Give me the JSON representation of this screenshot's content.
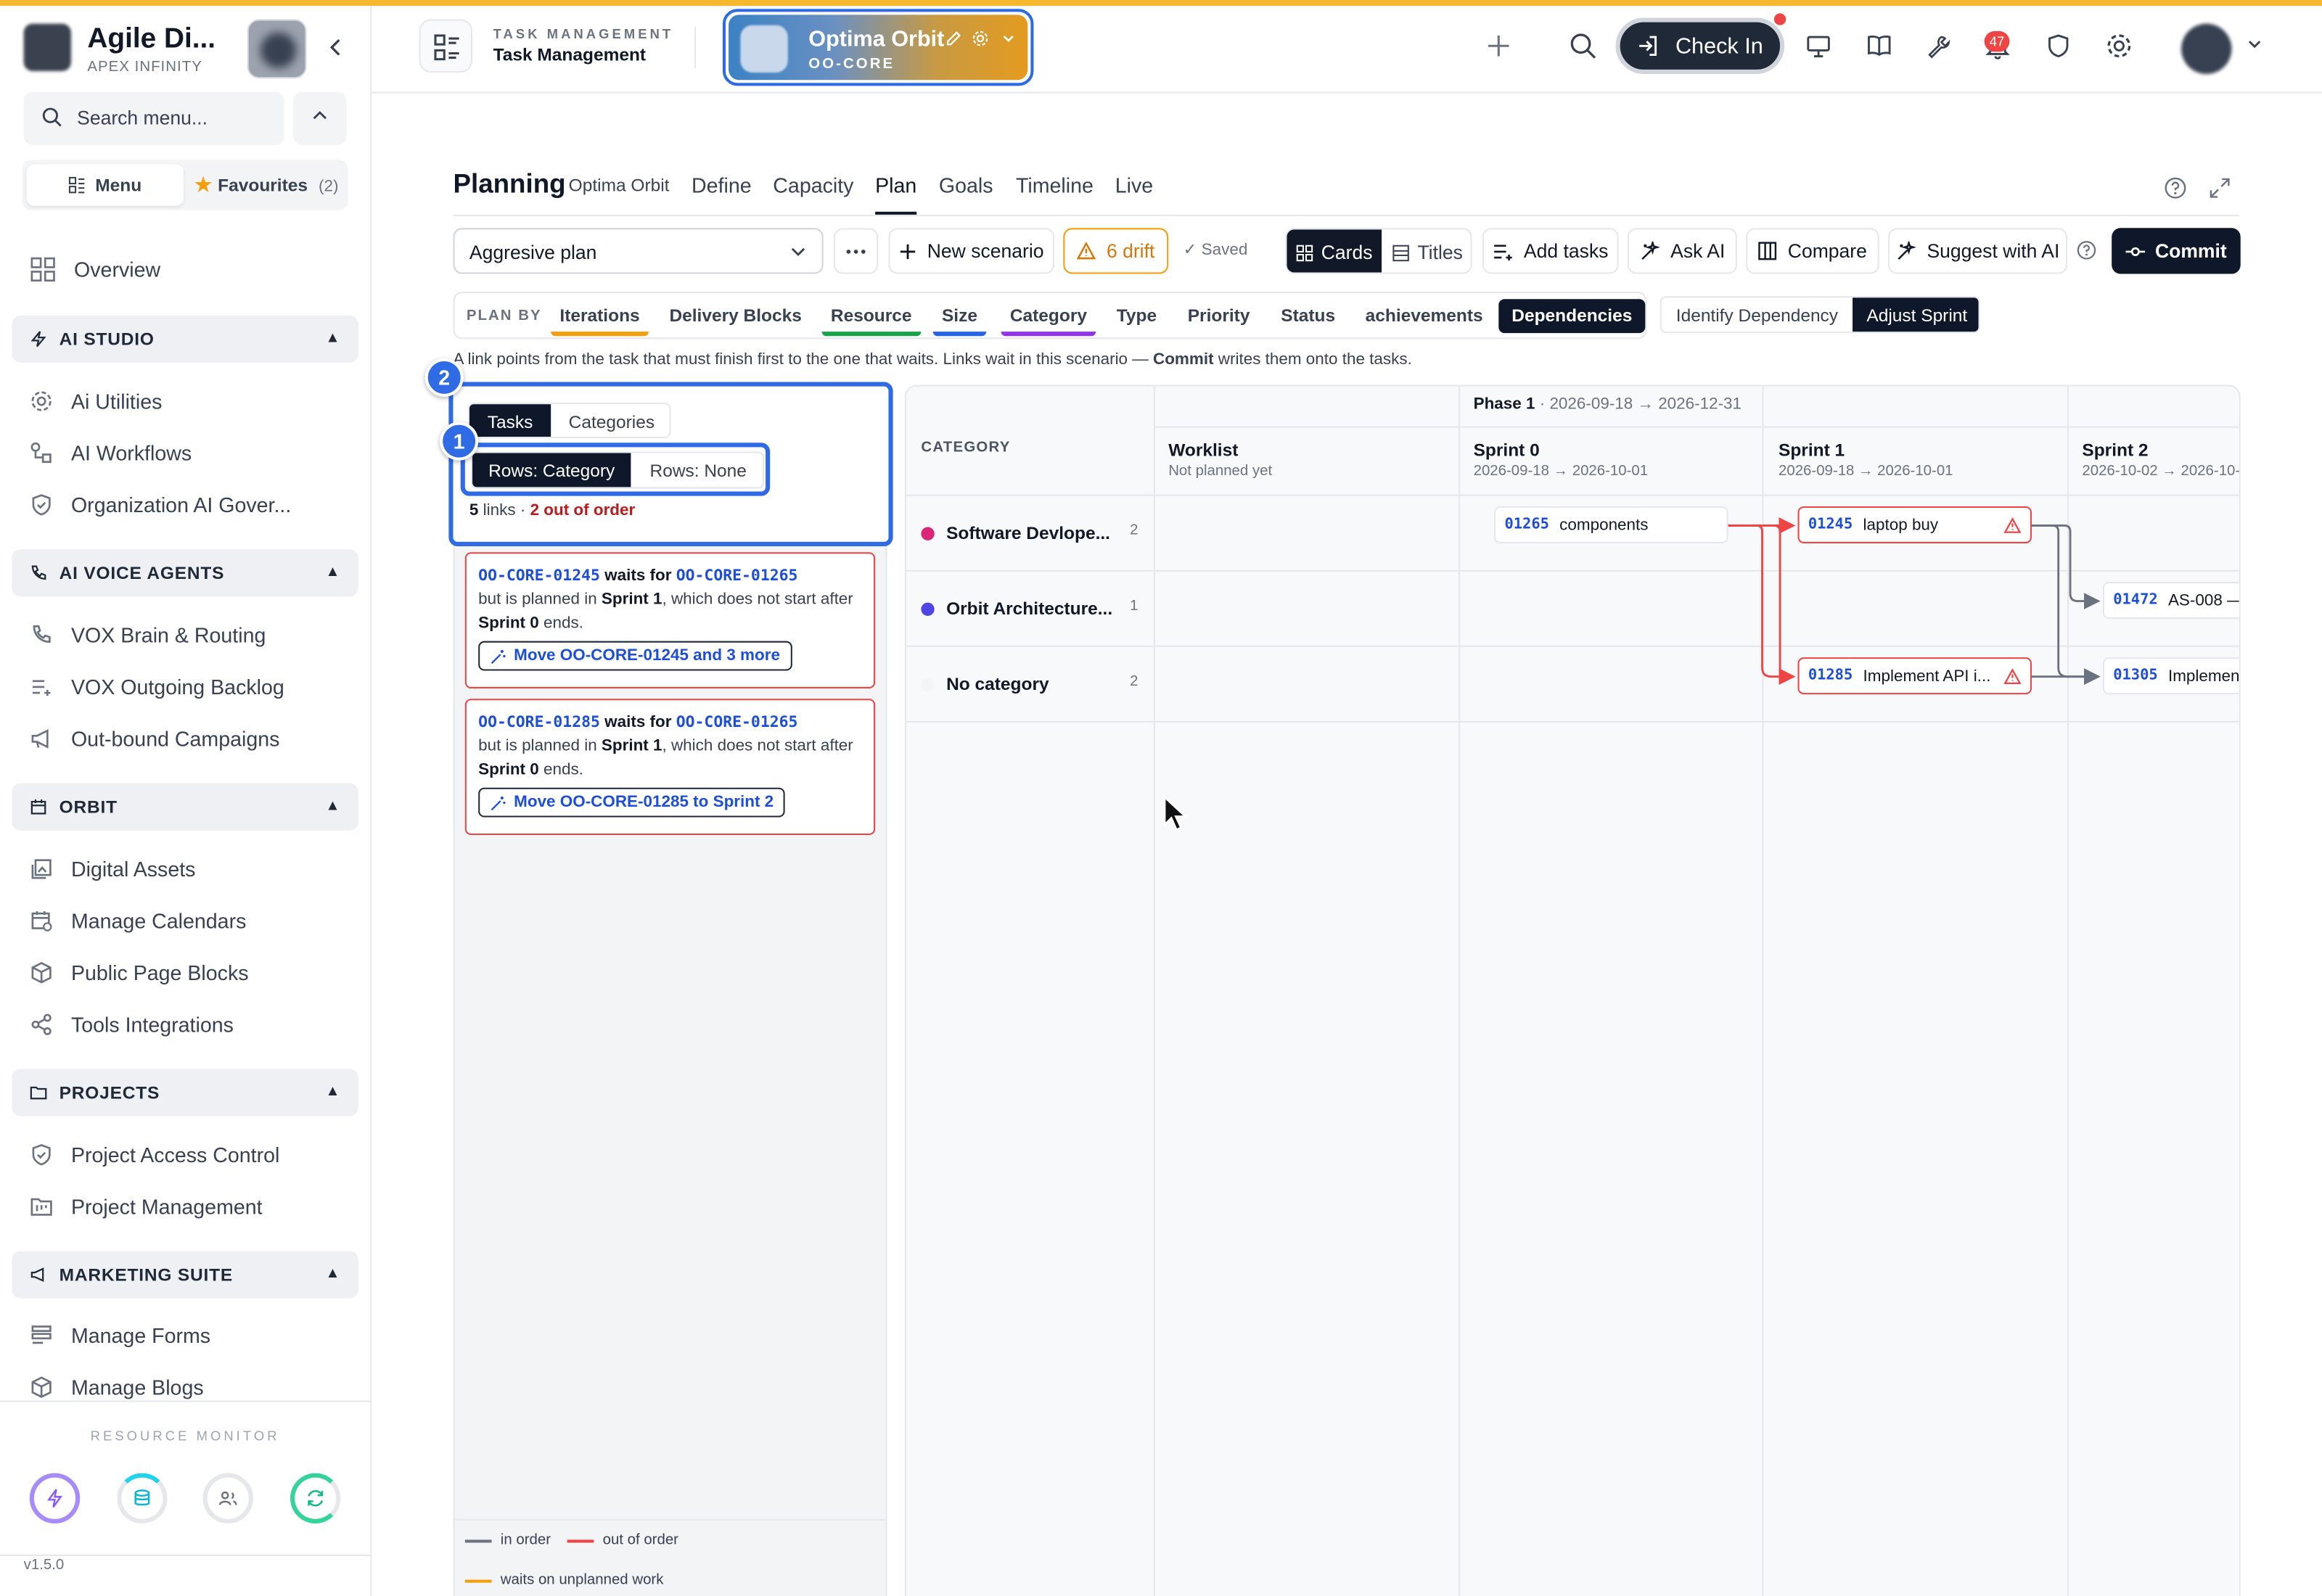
{
  "brand": {
    "title": "Agile Di...",
    "subtitle": "APEX INFINITY"
  },
  "sidebar": {
    "search_placeholder": "Search menu...",
    "tabs": [
      {
        "label": "Menu"
      },
      {
        "label": "Favourites",
        "count": "(2)"
      }
    ],
    "overview": "Overview",
    "sections": [
      {
        "title": "AI STUDIO",
        "items": [
          "Ai Utilities",
          "AI Workflows",
          "Organization AI Gover..."
        ]
      },
      {
        "title": "AI VOICE AGENTS",
        "items": [
          "VOX Brain & Routing",
          "VOX Outgoing Backlog",
          "Out-bound Campaigns"
        ]
      },
      {
        "title": "ORBIT",
        "items": [
          "Digital Assets",
          "Manage Calendars",
          "Public Page Blocks",
          "Tools Integrations"
        ]
      },
      {
        "title": "PROJECTS",
        "items": [
          "Project Access Control",
          "Project Management"
        ]
      },
      {
        "title": "MARKETING SUITE",
        "items": [
          "Manage Forms",
          "Manage Blogs"
        ]
      }
    ],
    "resource_monitor": "RESOURCE MONITOR",
    "version": "v1.5.0"
  },
  "header": {
    "module_small": "TASK MANAGEMENT",
    "module_main": "Task Management",
    "project_name": "Optima Orbit",
    "project_code": "OO-CORE",
    "checkin": "Check In",
    "notif_count": "47"
  },
  "planning": {
    "title": "Planning",
    "subtitle": "Optima Orbit",
    "tabs": [
      "Define",
      "Capacity",
      "Plan",
      "Goals",
      "Timeline",
      "Live"
    ],
    "active_tab": "Plan"
  },
  "toolbar": {
    "scenario": "Aggresive plan",
    "new_scenario": "New scenario",
    "drift": "6 drift",
    "saved": "Saved",
    "cards": "Cards",
    "titles": "Titles",
    "add_tasks": "Add tasks",
    "ask_ai": "Ask AI",
    "compare": "Compare",
    "suggest": "Suggest with AI",
    "commit": "Commit"
  },
  "plan_by": {
    "label": "PLAN BY",
    "options": [
      "Iterations",
      "Delivery Blocks",
      "Resource",
      "Size",
      "Category",
      "Type",
      "Priority",
      "Status",
      "achievements",
      "Dependencies"
    ],
    "underline_colors": {
      "Iterations": "#f59e0b",
      "Resource": "#16a34a",
      "Size": "#2563eb",
      "Category": "#9333ea"
    },
    "active": "Dependencies",
    "mode_options": [
      "Identify Dependency",
      "Adjust Sprint"
    ],
    "active_mode": "Adjust Sprint"
  },
  "hint": {
    "part1": "A link points from the task that must finish first to the one that waits. Links wait in this scenario — ",
    "bold": "Commit",
    "part2": " writes them onto the tasks."
  },
  "left_panel": {
    "toggle": [
      "Tasks",
      "Categories"
    ],
    "rows_toggle": [
      "Rows: Category",
      "Rows: None"
    ],
    "links_count": "5",
    "links_word": "links",
    "out_of_order": "2 out of order",
    "markers": [
      "1",
      "2"
    ],
    "conflicts": [
      {
        "task": "OO-CORE-01245",
        "waits": "waits for",
        "dep": "OO-CORE-01265",
        "line1": "but is planned in ",
        "sprint": "Sprint 1",
        "line2": ", which does not start after ",
        "dep_sprint": "Sprint 0",
        "line3": " ends.",
        "action": "Move OO-CORE-01245 and 3 more"
      },
      {
        "task": "OO-CORE-01285",
        "waits": "waits for",
        "dep": "OO-CORE-01265",
        "line1": "but is planned in ",
        "sprint": "Sprint 1",
        "line2": ", which does not start after ",
        "dep_sprint": "Sprint 0",
        "line3": " ends.",
        "action": "Move OO-CORE-01285 to Sprint 2"
      }
    ],
    "legend": [
      {
        "label": "in order",
        "color": "#6b7280"
      },
      {
        "label": "out of order",
        "color": "#ef4444"
      },
      {
        "label": "waits on unplanned work",
        "color": "#f59e0b"
      }
    ]
  },
  "board": {
    "phase": {
      "name": "Phase 1",
      "range": "· 2026-09-18 → 2026-12-31"
    },
    "category_header": "CATEGORY",
    "columns": [
      {
        "name": "Worklist",
        "dates": "Not planned yet"
      },
      {
        "name": "Sprint 0",
        "dates": "2026-09-18 → 2026-10-01"
      },
      {
        "name": "Sprint 1",
        "dates": "2026-09-18 → 2026-10-01"
      },
      {
        "name": "Sprint 2",
        "dates": "2026-10-02 → 2026-10-"
      }
    ],
    "categories": [
      {
        "name": "Software Devlope...",
        "count": "2",
        "color": "#db2777"
      },
      {
        "name": "Orbit Architecture...",
        "count": "1",
        "color": "#4f46e5"
      },
      {
        "name": "No category",
        "count": "2",
        "color": "#f3f4f6"
      }
    ],
    "tasks": [
      {
        "id": "01265",
        "title": "components"
      },
      {
        "id": "01245",
        "title": "laptop buy"
      },
      {
        "id": "01472",
        "title": "AS-008 —"
      },
      {
        "id": "01285",
        "title": "Implement API i..."
      },
      {
        "id": "01305",
        "title": "Implement"
      }
    ]
  }
}
